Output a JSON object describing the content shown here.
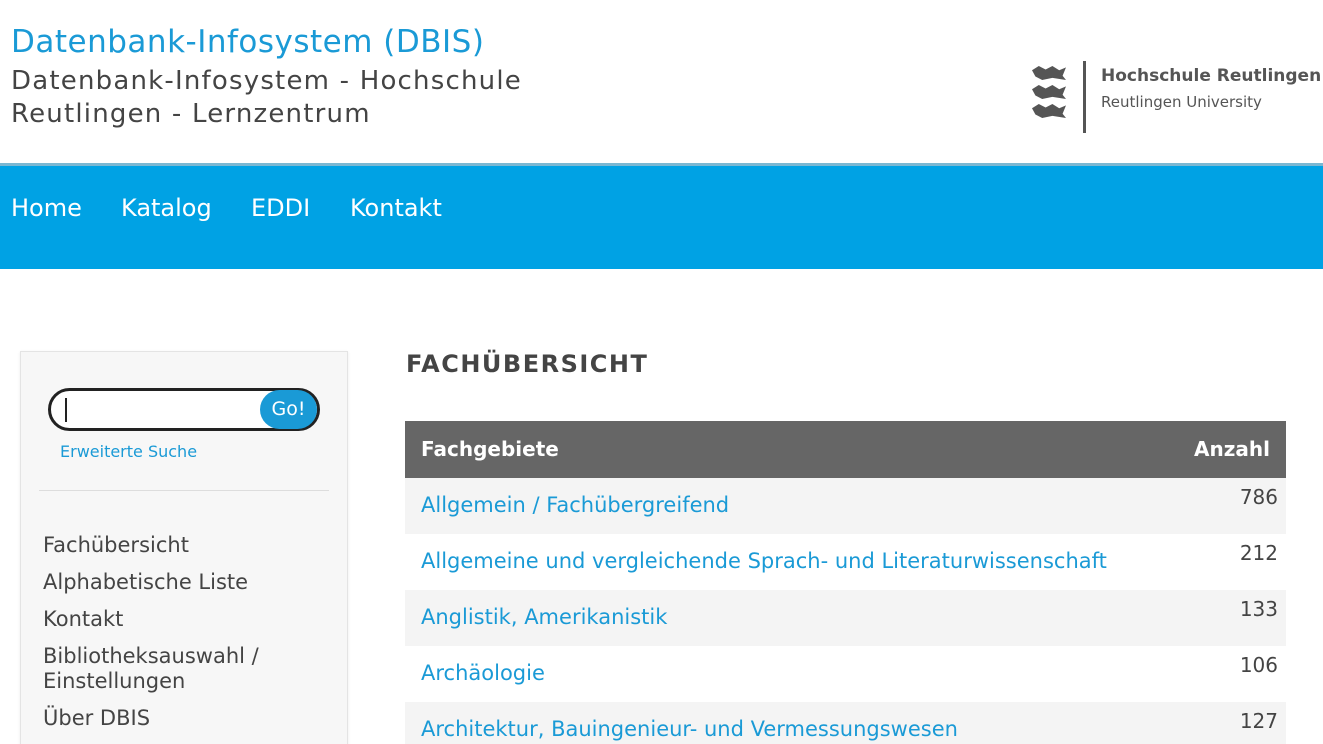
{
  "header": {
    "title": "Datenbank-Infosystem (DBIS)",
    "subtitle": "Datenbank-Infosystem - Hochschule Reutlingen - Lernzentrum",
    "logo_name": "Hochschule Reutlingen",
    "logo_sub": "Reutlingen University"
  },
  "nav": {
    "items": [
      {
        "label": "Home"
      },
      {
        "label": "Katalog"
      },
      {
        "label": "EDDI"
      },
      {
        "label": "Kontakt"
      }
    ]
  },
  "sidebar": {
    "search": {
      "value": "",
      "button_label": "Go!"
    },
    "advanced_search_label": "Erweiterte Suche",
    "menu": [
      {
        "label": "Fachübersicht"
      },
      {
        "label": "Alphabetische Liste"
      },
      {
        "label": "Kontakt"
      },
      {
        "label": "Bibliotheksauswahl / Einstellungen"
      },
      {
        "label": "Über DBIS"
      }
    ]
  },
  "main": {
    "title": "FACHÜBERSICHT",
    "table": {
      "headers": {
        "subject": "Fachgebiete",
        "count": "Anzahl"
      },
      "rows": [
        {
          "subject": "Allgemein / Fachübergreifend",
          "count": "786"
        },
        {
          "subject": "Allgemeine und vergleichende Sprach- und Literaturwissenschaft",
          "count": "212"
        },
        {
          "subject": "Anglistik, Amerikanistik",
          "count": "133"
        },
        {
          "subject": "Archäologie",
          "count": "106"
        },
        {
          "subject": "Architektur, Bauingenieur- und Vermessungswesen",
          "count": "127"
        }
      ]
    }
  }
}
